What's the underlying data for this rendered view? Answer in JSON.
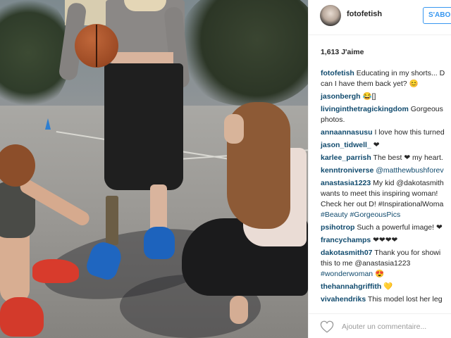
{
  "post": {
    "username": "fotofetish",
    "follow_label": "S'ABO",
    "likes": "1,613 J'aime",
    "comments": [
      {
        "user": "fotofetish",
        "text": " Educating in my shorts... D",
        "line2": "can I have them back yet? 😊"
      },
      {
        "user": "jasonbergh",
        "text": " 😂[]"
      },
      {
        "user": "livinginthetragickingdom",
        "text": " Gorgeous",
        "line2": "photos."
      },
      {
        "user": "annaannasusu",
        "text": " I love how this turned"
      },
      {
        "user": "jason_tidwell_",
        "text": " ❤"
      },
      {
        "user": "karlee_parrish",
        "text": " The best ❤ my heart."
      },
      {
        "user": "kenntroniverse",
        "text": " @matthewbushforev"
      },
      {
        "user": "anastasia1223",
        "text": " My kid @dakotasmith",
        "line2": "wants to meet this inspiring woman!",
        "line3": "Check her out D! #InspirationalWoma",
        "line4": "#Beauty #GorgeousPics"
      },
      {
        "user": "psihotrop",
        "text": " Such a powerful image! ❤"
      },
      {
        "user": "francychamps",
        "text": " ❤❤❤❤"
      },
      {
        "user": "dakotasmith07",
        "text": " Thank you for showi",
        "line2": "this to me @anastasia1223",
        "line3": "#wonderwoman 😍"
      },
      {
        "user": "thehannahgriffith",
        "text": " 💛"
      },
      {
        "user": "vivahendriks",
        "text": " This model lost her leg"
      }
    ],
    "add_comment_placeholder": "Ajouter un commentaire..."
  },
  "colors": {
    "link": "#3897f0",
    "username": "#114b6e"
  },
  "icons": {
    "heart": "heart-icon",
    "avatar": "avatar"
  }
}
